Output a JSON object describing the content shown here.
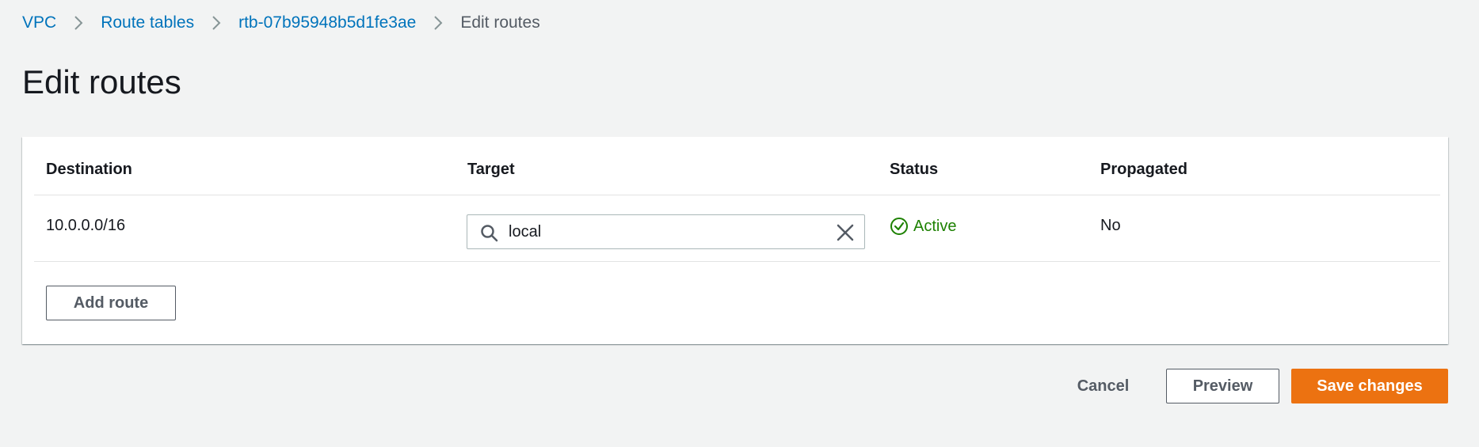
{
  "breadcrumb": {
    "items": [
      {
        "label": "VPC"
      },
      {
        "label": "Route tables"
      },
      {
        "label": "rtb-07b95948b5d1fe3ae"
      }
    ],
    "current": "Edit routes"
  },
  "page": {
    "title": "Edit routes"
  },
  "routes_table": {
    "columns": [
      "Destination",
      "Target",
      "Status",
      "Propagated"
    ],
    "rows": [
      {
        "destination": "10.0.0.0/16",
        "target": "local",
        "status": "Active",
        "propagated": "No"
      }
    ],
    "add_route_label": "Add route"
  },
  "footer": {
    "cancel_label": "Cancel",
    "preview_label": "Preview",
    "save_label": "Save changes"
  },
  "icons": {
    "breadcrumb_separator": "chevron-right-icon",
    "target_search": "search-icon",
    "target_clear": "close-icon",
    "status": "check-circle-icon"
  },
  "colors": {
    "link": "#0073bb",
    "primary": "#ec7211",
    "success": "#1d8102",
    "background": "#f2f3f3"
  }
}
